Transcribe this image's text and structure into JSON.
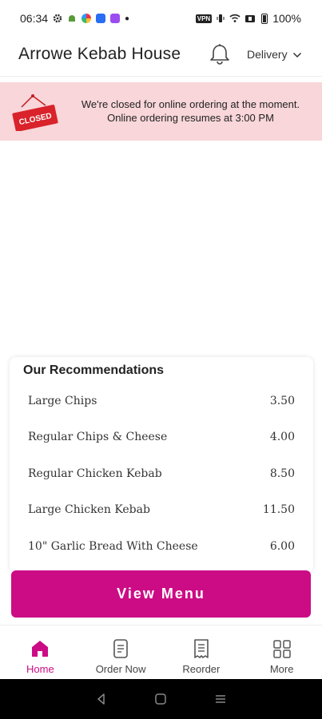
{
  "status_bar": {
    "time": "06:34",
    "battery": "100%",
    "vpn_label": "VPN"
  },
  "header": {
    "title": "Arrowe Kebab House",
    "delivery_label": "Delivery"
  },
  "banner": {
    "sign_text": "CLOSED",
    "line1": "We're closed for online ordering at the moment.",
    "line2": "Online ordering resumes at 3:00 PM"
  },
  "recommendations": {
    "title": "Our Recommendations",
    "items": [
      {
        "name": "Large Chips",
        "price": "3.50"
      },
      {
        "name": "Regular Chips & Cheese",
        "price": "4.00"
      },
      {
        "name": "Regular Chicken Kebab",
        "price": "8.50"
      },
      {
        "name": "Large Chicken Kebab",
        "price": "11.50"
      },
      {
        "name": "10\" Garlic Bread With Cheese",
        "price": "6.00"
      }
    ]
  },
  "view_menu": {
    "label": "View Menu"
  },
  "bottom_nav": {
    "items": [
      {
        "label": "Home",
        "icon": "home-icon",
        "active": true
      },
      {
        "label": "Order Now",
        "icon": "order-icon"
      },
      {
        "label": "Reorder",
        "icon": "receipt-icon"
      },
      {
        "label": "More",
        "icon": "grid-icon"
      }
    ]
  },
  "colors": {
    "accent": "#cc0c85",
    "banner_bg": "#f8d6d9",
    "closed_sign": "#d9222a"
  }
}
